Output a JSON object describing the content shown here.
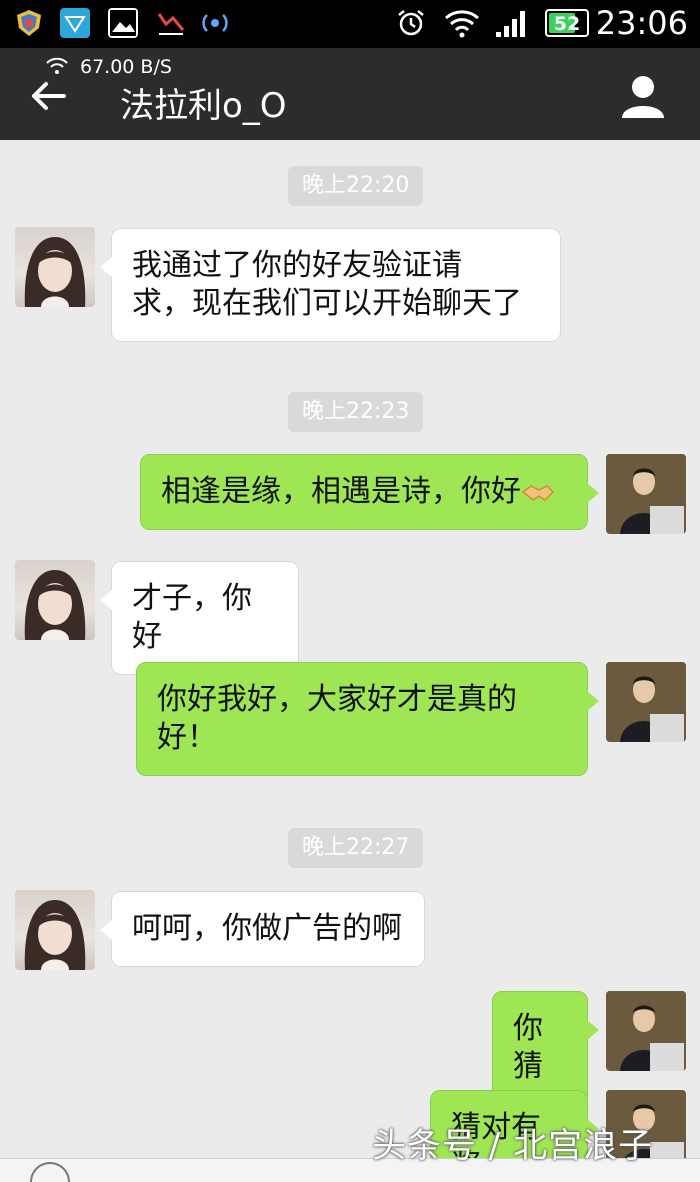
{
  "status_bar": {
    "battery": "52",
    "time": "23:06"
  },
  "header": {
    "net_speed": "67.00 B/S",
    "title": "法拉利o_O",
    "back_icon": "back-arrow-icon",
    "profile_icon": "person-icon"
  },
  "messages": [
    {
      "type": "time",
      "text": "晚上22:20"
    },
    {
      "type": "left",
      "text_line1": "我通过了你的好友验证请",
      "text_line2": "求，现在我们可以开始聊天了"
    },
    {
      "type": "time",
      "text": "晚上22:23"
    },
    {
      "type": "right",
      "text": "相逢是缘，相遇是诗，你好"
    },
    {
      "type": "left",
      "text": "才子，你好"
    },
    {
      "type": "right",
      "text_line1": "你好我好，大家好才是真的",
      "text_line2": "好！"
    },
    {
      "type": "time",
      "text": "晚上22:27"
    },
    {
      "type": "left",
      "text": "呵呵，你做广告的啊"
    },
    {
      "type": "right",
      "text": "你猜"
    },
    {
      "type": "right",
      "text": "猜对有奖"
    }
  ],
  "watermark": "头条号 / 北宫浪子",
  "colors": {
    "my_bubble": "#9fe655",
    "their_bubble": "#ffffff",
    "title_bar": "#2c2c2c"
  }
}
